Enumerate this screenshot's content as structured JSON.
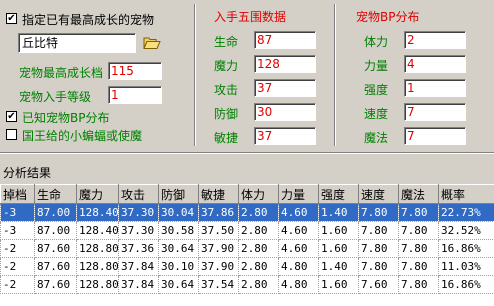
{
  "left": {
    "specify_max_label": "指定已有最高成长的宠物",
    "pet_name": "丘比特",
    "max_growth_label": "宠物最高成长档",
    "max_growth_value": "115",
    "obtain_level_label": "宠物入手等级",
    "obtain_level_value": "1",
    "known_bp_label": "已知宠物BP分布",
    "king_label": "国王给的小蝙蝠或使魔",
    "specify_max_checked": true,
    "known_bp_checked": true,
    "king_checked": false
  },
  "stats": {
    "title": "入手五围数据",
    "rows": [
      {
        "label": "生命",
        "value": "87"
      },
      {
        "label": "魔力",
        "value": "128"
      },
      {
        "label": "攻击",
        "value": "37"
      },
      {
        "label": "防御",
        "value": "30"
      },
      {
        "label": "敏捷",
        "value": "37"
      }
    ]
  },
  "bp": {
    "title": "宠物BP分布",
    "rows": [
      {
        "label": "体力",
        "value": "2"
      },
      {
        "label": "力量",
        "value": "4"
      },
      {
        "label": "强度",
        "value": "1"
      },
      {
        "label": "速度",
        "value": "7"
      },
      {
        "label": "魔法",
        "value": "7"
      }
    ]
  },
  "results": {
    "title": "分析结果",
    "headers": [
      "掉档",
      "生命",
      "魔力",
      "攻击",
      "防御",
      "敏捷",
      "体力",
      "力量",
      "强度",
      "速度",
      "魔法",
      "概率"
    ],
    "rows": [
      [
        "-3",
        "87.00",
        "128.40",
        "37.30",
        "30.04",
        "37.86",
        "2.80",
        "4.60",
        "1.40",
        "7.80",
        "7.80",
        "22.73%"
      ],
      [
        "-3",
        "87.00",
        "128.40",
        "37.30",
        "30.58",
        "37.50",
        "2.80",
        "4.60",
        "1.60",
        "7.80",
        "7.80",
        "32.52%"
      ],
      [
        "-2",
        "87.60",
        "128.80",
        "37.36",
        "30.64",
        "37.90",
        "2.80",
        "4.60",
        "1.60",
        "7.80",
        "7.80",
        "16.86%"
      ],
      [
        "-2",
        "87.60",
        "128.80",
        "37.84",
        "30.10",
        "37.90",
        "2.80",
        "4.80",
        "1.40",
        "7.80",
        "7.80",
        "11.03%"
      ],
      [
        "-2",
        "87.60",
        "128.80",
        "37.84",
        "30.64",
        "37.54",
        "2.80",
        "4.80",
        "1.60",
        "7.60",
        "7.80",
        "16.86%"
      ]
    ],
    "selected_row": 0
  },
  "colors": {
    "label_green": "#008000",
    "accent_red": "#e00000",
    "selection": "#316ac5"
  },
  "icons": {
    "open_folder": "folder-open-icon",
    "check": "checkmark-icon"
  }
}
